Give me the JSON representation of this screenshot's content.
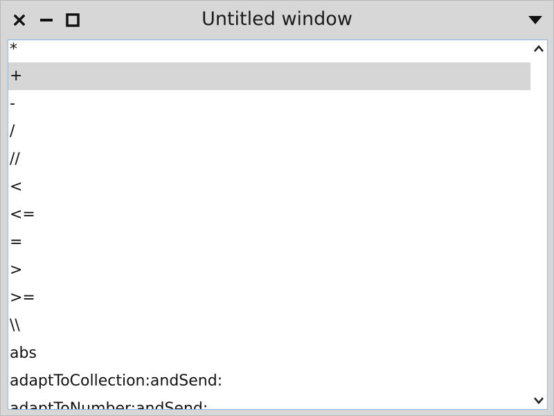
{
  "window": {
    "title": "Untitled window"
  },
  "titlebar": {
    "close_icon": "close-icon",
    "minimize_icon": "minimize-icon",
    "maximize_icon": "maximize-icon",
    "menu_icon": "triangle-down-icon"
  },
  "list": {
    "selected_index": 1,
    "items": [
      "*",
      "+",
      "-",
      "/",
      "//",
      "<",
      "<=",
      "=",
      ">",
      ">=",
      "\\\\",
      "abs",
      "adaptToCollection:andSend:",
      "adaptToNumber:andSend:"
    ]
  },
  "scrollbar": {
    "up_icon": "chevron-up-icon",
    "down_icon": "chevron-down-icon"
  }
}
